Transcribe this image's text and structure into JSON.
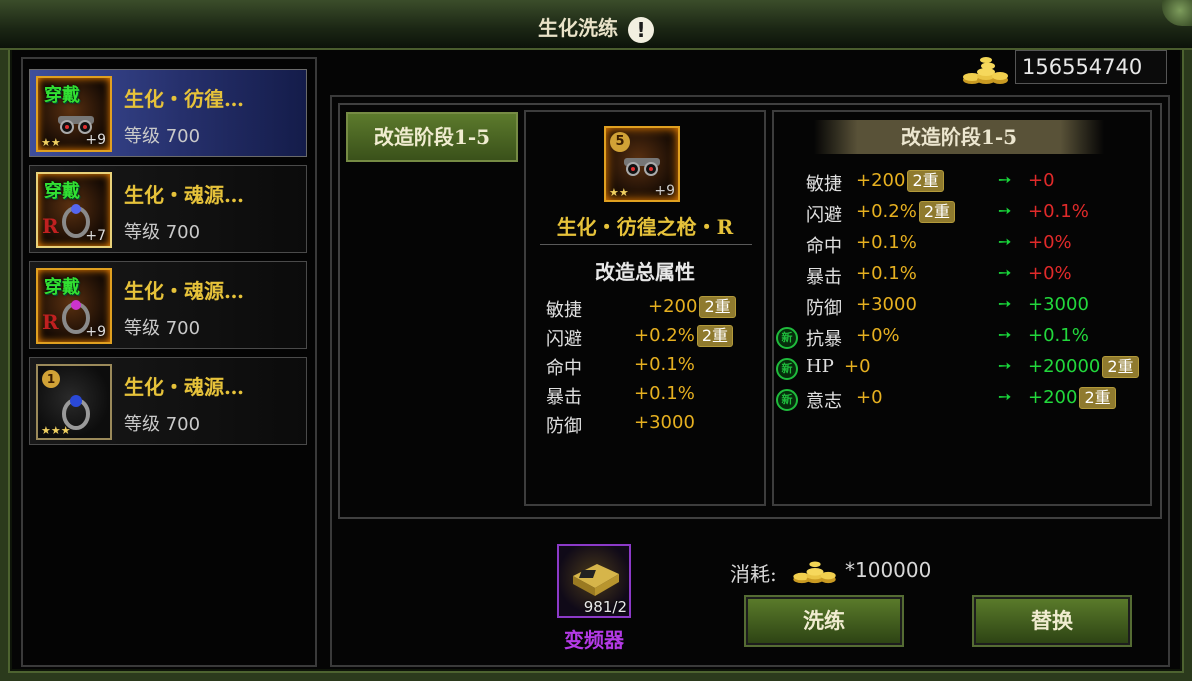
{
  "window": {
    "title": "生化洗练",
    "info_icon": "!"
  },
  "currency": {
    "icon": "gold-coins-icon",
    "amount": "156554740"
  },
  "inventory": [
    {
      "wear": "穿戴",
      "name": "生化・彷徨…",
      "level": "等级 700",
      "plus": "+9",
      "icon": "gun-gear-icon",
      "selected": true
    },
    {
      "wear": "穿戴",
      "name": "生化・魂源…",
      "level": "等级 700",
      "plus": "+7",
      "icon": "ring-gear-icon",
      "selected": false
    },
    {
      "wear": "穿戴",
      "name": "生化・魂源…",
      "level": "等级 700",
      "plus": "+9",
      "icon": "ring-gear-icon",
      "selected": false
    },
    {
      "badge": "1",
      "name": "生化・魂源…",
      "level": "等级 700",
      "icon": "ring-gear-icon",
      "selected": false
    }
  ],
  "stage_tab": "改造阶段1-5",
  "item": {
    "badge": "5",
    "plus": "+9",
    "name": "生化・彷徨之枪・R"
  },
  "total_attrs": {
    "title": "改造总属性",
    "rows": [
      {
        "k": "敏捷",
        "v": "+200",
        "tag": "2重"
      },
      {
        "k": "闪避",
        "v": "+0.2%",
        "tag": "2重"
      },
      {
        "k": "命中",
        "v": "+0.1%"
      },
      {
        "k": "暴击",
        "v": "+0.1%"
      },
      {
        "k": "防御",
        "v": "+3000"
      }
    ]
  },
  "stage": {
    "title": "改造阶段1-5",
    "new_label": "新",
    "arrow": "➙",
    "rows": [
      {
        "k": "敏捷",
        "v": "+200",
        "tag": "2重",
        "nv": "+0",
        "nv_color": "red"
      },
      {
        "k": "闪避",
        "v": "+0.2%",
        "tag": "2重",
        "nv": "+0.1%",
        "nv_color": "red"
      },
      {
        "k": "命中",
        "v": "+0.1%",
        "nv": "+0%",
        "nv_color": "red"
      },
      {
        "k": "暴击",
        "v": "+0.1%",
        "nv": "+0%",
        "nv_color": "red"
      },
      {
        "k": "防御",
        "v": "+3000",
        "nv": "+3000",
        "nv_color": "green"
      },
      {
        "k": "抗暴",
        "v": "+0%",
        "nv": "+0.1%",
        "nv_color": "green",
        "new": true
      },
      {
        "k": "HP",
        "v": "+0",
        "nv": "+20000",
        "nv_tag": "2重",
        "nv_color": "green",
        "new": true
      },
      {
        "k": "意志",
        "v": "+0",
        "nv": "+200",
        "nv_tag": "2重",
        "nv_color": "green",
        "new": true
      }
    ]
  },
  "material": {
    "name": "变频器",
    "count": "981/2",
    "icon": "frequency-changer-icon"
  },
  "cost": {
    "label": "消耗:",
    "icon": "gold-coins-icon",
    "value": "*100000"
  },
  "buttons": {
    "refine": "洗练",
    "replace": "替换"
  }
}
